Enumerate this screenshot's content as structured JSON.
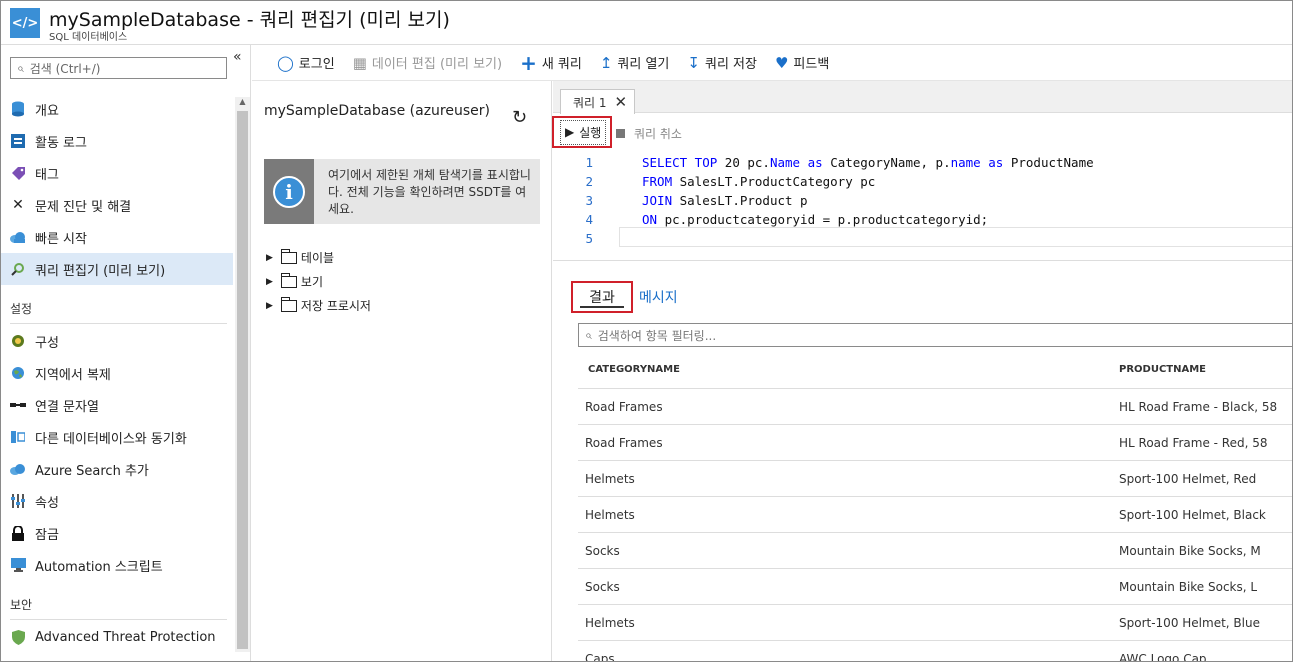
{
  "header": {
    "title": "mySampleDatabase - 쿼리 편집기 (미리 보기)",
    "subtitle": "SQL 데이터베이스",
    "icon": "sql-database-icon"
  },
  "sidebar": {
    "search_placeholder": "검색 (Ctrl+/)",
    "collapse_label": "«",
    "items": [
      {
        "label": "개요",
        "icon": "overview-icon"
      },
      {
        "label": "활동 로그",
        "icon": "activity-log-icon"
      },
      {
        "label": "태그",
        "icon": "tag-icon"
      },
      {
        "label": "문제 진단 및 해결",
        "icon": "tools-icon"
      },
      {
        "label": "빠른 시작",
        "icon": "cloud-icon"
      },
      {
        "label": "쿼리 편집기 (미리 보기)",
        "icon": "query-editor-icon",
        "active": true
      }
    ],
    "section_settings": "설정",
    "settings_items": [
      {
        "label": "구성",
        "icon": "configure-icon"
      },
      {
        "label": "지역에서 복제",
        "icon": "globe-icon"
      },
      {
        "label": "연결 문자열",
        "icon": "connection-icon"
      },
      {
        "label": "다른 데이터베이스와 동기화",
        "icon": "sync-icon"
      },
      {
        "label": "Azure Search 추가",
        "icon": "search-cloud-icon"
      },
      {
        "label": "속성",
        "icon": "properties-icon"
      },
      {
        "label": "잠금",
        "icon": "lock-icon"
      },
      {
        "label": "Automation 스크립트",
        "icon": "automation-icon"
      }
    ],
    "section_security": "보안",
    "security_items": [
      {
        "label": "Advanced Threat Protection",
        "icon": "shield-icon"
      }
    ]
  },
  "toolbar": {
    "login": "로그인",
    "edit_data": "데이터 편집 (미리 보기)",
    "new_query": "새 쿼리",
    "open_query": "쿼리 열기",
    "save_query": "쿼리 저장",
    "feedback": "피드백"
  },
  "explorer": {
    "db_name": "mySampleDatabase (azureuser)",
    "info_text": "여기에서 제한된 개체 탐색기를 표시합니다. 전체 기능을 확인하려면 SSDT를 여세요.",
    "tree": [
      "테이블",
      "보기",
      "저장 프로시저"
    ]
  },
  "editor": {
    "tab_label": "쿼리 1",
    "run_label": "실행",
    "cancel_label": "쿼리 취소",
    "line_numbers": [
      "1",
      "2",
      "3",
      "4",
      "5"
    ],
    "code": [
      {
        "kw1": "SELECT TOP ",
        "num": "20",
        "t1": " pc.",
        "kw2": "Name",
        "t2": " ",
        "kw3": "as",
        "t3": " CategoryName, p.",
        "kw4": "name",
        "t4": " ",
        "kw5": "as",
        "t5": " ProductName"
      },
      {
        "kw1": "FROM",
        "t1": " SalesLT.ProductCategory pc"
      },
      {
        "kw1": "JOIN",
        "t1": " SalesLT.Product p"
      },
      {
        "kw1": "ON",
        "t1": " pc.productcategoryid = p.productcategoryid;"
      }
    ]
  },
  "results": {
    "tab_results": "결과",
    "tab_messages": "메시지",
    "filter_placeholder": "검색하여 항목 필터링...",
    "columns": [
      "CATEGORYNAME",
      "PRODUCTNAME"
    ],
    "rows": [
      [
        "Road Frames",
        "HL Road Frame - Black, 58"
      ],
      [
        "Road Frames",
        "HL Road Frame - Red, 58"
      ],
      [
        "Helmets",
        "Sport-100 Helmet, Red"
      ],
      [
        "Helmets",
        "Sport-100 Helmet, Black"
      ],
      [
        "Socks",
        "Mountain Bike Socks, M"
      ],
      [
        "Socks",
        "Mountain Bike Socks, L"
      ],
      [
        "Helmets",
        "Sport-100 Helmet, Blue"
      ],
      [
        "Caps",
        "AWC Logo Cap"
      ]
    ]
  },
  "colors": {
    "accent": "#1a6fc9",
    "highlight_border": "#d0202a",
    "active_nav": "#dce9f7"
  }
}
